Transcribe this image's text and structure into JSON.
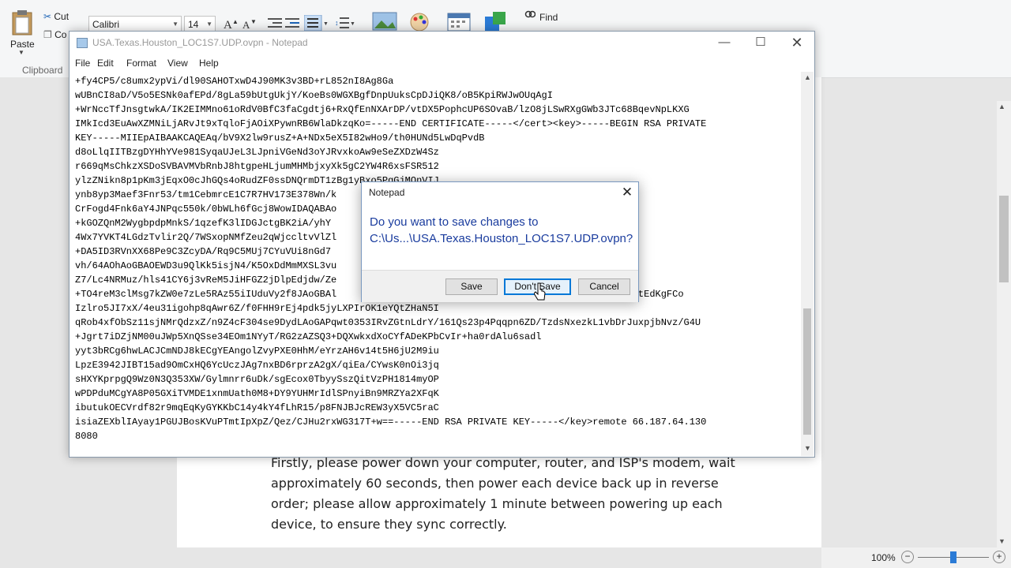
{
  "wordpad": {
    "ribbon": {
      "paste_label": "Paste",
      "cut_label": "Cut",
      "copy_label": "Co",
      "clipboard_group": "Clipboard",
      "font_name": "Calibri",
      "font_size": "14",
      "find_label": "Find"
    },
    "document_text": "Firstly, please power down your computer, router, and ISP's modem, wait approximately 60 seconds, then power each device back up in reverse order; please allow approximately 1 minute between powering up each device, to ensure they sync correctly.",
    "zoom": "100%"
  },
  "notepad": {
    "title": "USA.Texas.Houston_LOC1S7.UDP.ovpn - Notepad",
    "menu": [
      "File",
      "Edit",
      "Format",
      "View",
      "Help"
    ],
    "content": "+fy4CP5/c8umx2ypVi/dl90SAHOTxwD4J90MK3v3BD+rL852nI8Ag8Ga\nwUBnCI8aD/V5o5ESNk0afEPd/8gLa59bUtgUkjY/KoeBs0WGXBgfDnpUuksCpDJiQK8/oB5KpiRWJwOUqAgI\n+WrNccTfJnsgtwkA/IK2EIMMno61oRdV0BfC3faCgdtj6+RxQfEnNXArDP/vtDX5PophcUP6SOvaB/lzO8jLSwRXgGWb3JTc68BqevNpLKXG\nIMkIcd3EuAwXZMNiLjARvJt9xTqloFjAOiXPywnRB6WlaDkzqKo=-----END CERTIFICATE-----</cert><key>-----BEGIN RSA PRIVATE\nKEY-----MIIEpAIBAAKCAQEAq/bV9X2lw9rusZ+A+NDx5eX5I82wHo9/th0HUNd5LwDqPvdB\nd8oLlqIITBzgDYHhYVe981SyqaUJeL3LJpniVGeNd3oYJRvxkoAw9eSeZXDzW4Sz\nr669qMsChkzXSDoSVBAVMVbRnbJ8htgpeHLjumMHMbjxyXk5gC2YW4R6xsFSR512\nylzZNikn8p1pKm3jEqxO0cJhGQs4oRudZF0ssDNQrmDT1zBg1yBxo5PgGjMOnVIJ\nynb8yp3Maef3Fnr53/tm1CebmrcE1C7R7HV173E378Wn/k                                    \nCrFogd4Fnk6aY4JNPqc550k/0bWLh6fGcj8WowIDAQABAo                                       UBR90wgPVr3o\n+kGOZQnM2WygbpdpMnkS/1qzefK3lIDGJctgBK2iA/yhY                                        S+\n4Wx7YVKT4LGdzTvlir2Q/7WSxopNMfZeu2qWjccltvVlZl                                       i++Wj\n+DA5ID3RVnXX68Pe9C3ZcyDA/Rq9C5MUj7CYuVUi8nGd7                                        2BGmmQBqx\nvh/64AOhAoGBAOEWD3u9QlKk5isjN4/K5OxDdMmMXSL3vu\nZ7/Lc4NRMuz/hls41CY6j3vReM5JiHFGZ2jDlpEdjdw/Ze\n+TO4reM3clMsg7kZW0e7zLe5RAz55iIUduVy2f8JAoGBAl                                      2upqhjyPC6x50S9tEdKgFCo\nIzlro5JI7xX/4eu31igohp8qAwr6Z/f0FHH9rEj4pdk5jyLXPIrOK1eYQtZHaN5I\nqRob4xfObSz11sjNMrQdzxZ/n9Z4cF304se9DydLAoGAPqwt0353IRvZGtnLdrY/161Qs23p4Pqqpn6ZD/TzdsNxezkL1vbDrJuxpjbNvz/G4U\n+Jgrt7iDZjNM00uJWp5XnQSse34EOm1NYyT/RG2zAZSQ3+DQXwkxdXoCYfADeKPbCvIr+ha0rdAlu6sadl\nyyt3bRCg6hwLACJCmNDJ8kECgYEAngolZvyPXE0HhM/eYrzAH6v14t5H6jU2M9iu\nLpzE3942JIBT15ad9OmCxHQ6YcUczJAg7nxBD6rprzA2gX/qiEa/CYwsK0nOi3jq\nsHXYKprpgQ9Wz0N3Q353XW/Gylmnrr6uDk/sgEcox0TbyySszQitVzPH1814myOP\nwPDPduMCgYA8P05GXiTVMDE1xnmUath0M8+DY9YUHMrIdlSPnyiBn9MRZYa2XFqK\nibutukOECVrdf82r9mqEqKyGYKKbC14y4kY4fLhR15/p8FNJBJcREW3yX5VC5raC\nisiaZEXblIAyay1PGUJBosKVuPTmtIpXpZ/Qez/CJHu2rxWG317T+w==-----END RSA PRIVATE KEY-----</key>remote 66.187.64.130\n8080"
  },
  "dialog": {
    "title": "Notepad",
    "message": "Do you want to save changes to C:\\Us...\\USA.Texas.Houston_LOC1S7.UDP.ovpn?",
    "buttons": {
      "save": "Save",
      "dont_save": "Don't Save",
      "cancel": "Cancel"
    }
  }
}
